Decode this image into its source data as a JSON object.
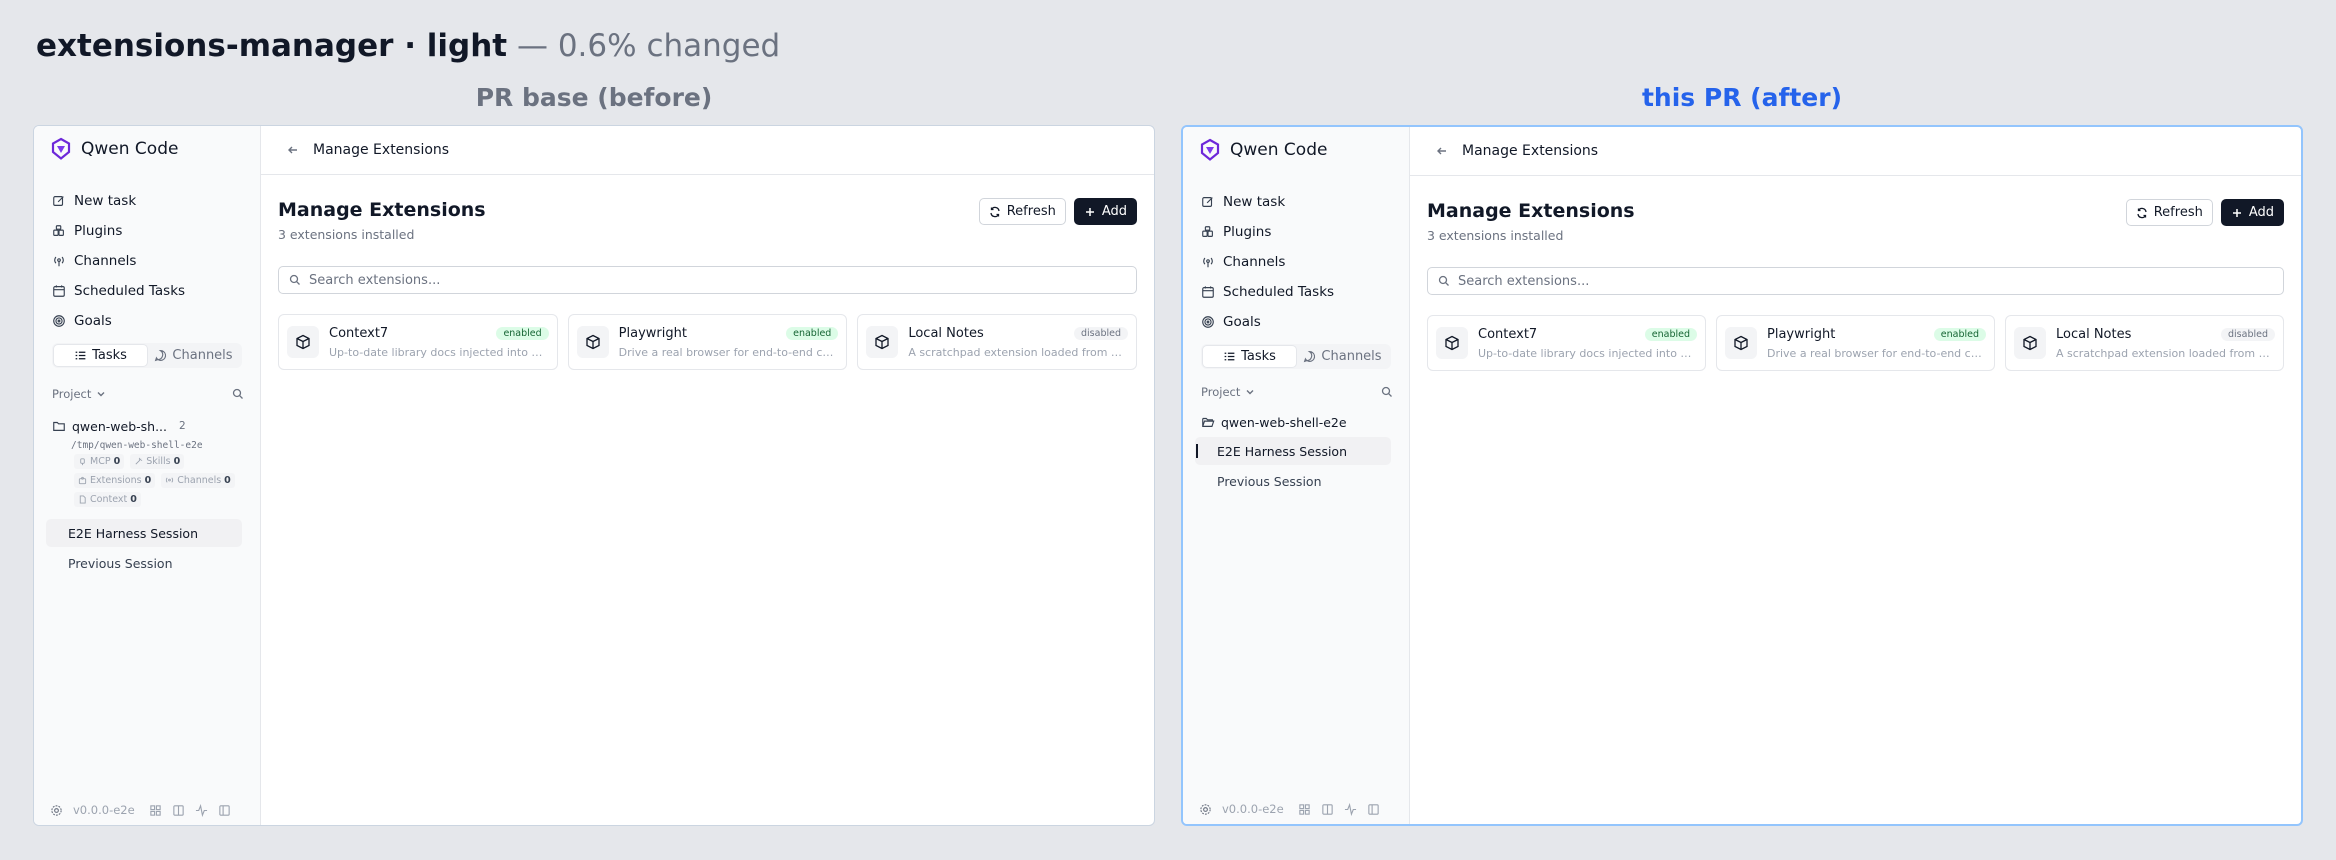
{
  "header": {
    "name": "extensions-manager · light",
    "sep": " — ",
    "changed": "0.6% changed"
  },
  "panels": [
    {
      "label": "PR base (before)",
      "app_name": "Qwen Code",
      "nav": [
        {
          "label": "New task",
          "icon": "edit-icon"
        },
        {
          "label": "Plugins",
          "icon": "plugins-icon"
        },
        {
          "label": "Channels",
          "icon": "radio-icon"
        },
        {
          "label": "Scheduled Tasks",
          "icon": "calendar-icon"
        },
        {
          "label": "Goals",
          "icon": "target-icon"
        }
      ],
      "seg_tasks": "Tasks",
      "seg_channels": "Channels",
      "project_label": "Project",
      "workspace": {
        "name": "qwen-web-sh...",
        "count": "2",
        "path": "/tmp/qwen-web-shell-e2e",
        "chips": [
          {
            "label": "MCP",
            "value": "0",
            "icon": "plug-icon"
          },
          {
            "label": "Skills",
            "value": "0",
            "icon": "wand-icon"
          },
          {
            "label": "Extensions",
            "value": "0",
            "icon": "puzzle-icon"
          },
          {
            "label": "Channels",
            "value": "0",
            "icon": "radio-icon"
          },
          {
            "label": "Context",
            "value": "0",
            "icon": "file-icon"
          }
        ]
      },
      "sessions": [
        "E2E Harness Session",
        "Previous Session"
      ],
      "version": "v0.0.0-e2e",
      "page_title_bar": "Manage Extensions",
      "title": "Manage Extensions",
      "subtitle": "3 extensions installed",
      "refresh_label": "Refresh",
      "add_label": "Add",
      "search_placeholder": "Search extensions...",
      "extensions": [
        {
          "name": "Context7",
          "status": "enabled",
          "desc": "Up-to-date library docs injected into your prompts"
        },
        {
          "name": "Playwright",
          "status": "enabled",
          "desc": "Drive a real browser for end-to-end checks"
        },
        {
          "name": "Local Notes",
          "status": "disabled",
          "desc": "A scratchpad extension loaded from disk"
        }
      ]
    },
    {
      "label": "this PR (after)",
      "app_name": "Qwen Code",
      "nav": [
        {
          "label": "New task",
          "icon": "edit-icon"
        },
        {
          "label": "Plugins",
          "icon": "plugins-icon"
        },
        {
          "label": "Channels",
          "icon": "radio-icon"
        },
        {
          "label": "Scheduled Tasks",
          "icon": "calendar-icon"
        },
        {
          "label": "Goals",
          "icon": "target-icon"
        }
      ],
      "seg_tasks": "Tasks",
      "seg_channels": "Channels",
      "project_label": "Project",
      "workspace": {
        "name": "qwen-web-shell-e2e"
      },
      "sessions": [
        "E2E Harness Session",
        "Previous Session"
      ],
      "version": "v0.0.0-e2e",
      "page_title_bar": "Manage Extensions",
      "title": "Manage Extensions",
      "subtitle": "3 extensions installed",
      "refresh_label": "Refresh",
      "add_label": "Add",
      "search_placeholder": "Search extensions...",
      "extensions": [
        {
          "name": "Context7",
          "status": "enabled",
          "desc": "Up-to-date library docs injected into your prompts"
        },
        {
          "name": "Playwright",
          "status": "enabled",
          "desc": "Drive a real browser for end-to-end checks"
        },
        {
          "name": "Local Notes",
          "status": "disabled",
          "desc": "A scratchpad extension loaded from disk"
        }
      ]
    }
  ],
  "colors": {
    "accent_after": "#2563eb",
    "label_before": "#6b7280",
    "enabled_bg": "#dcfce7",
    "enabled_fg": "#166534"
  }
}
